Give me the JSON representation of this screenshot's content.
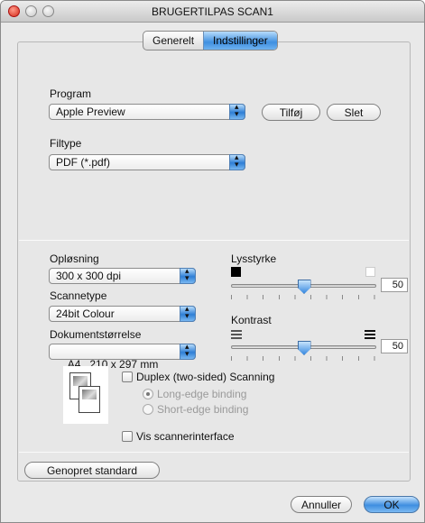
{
  "window": {
    "title": "BRUGERTILPAS SCAN1"
  },
  "tabs": [
    {
      "label": "Generelt",
      "active": false
    },
    {
      "label": "Indstillinger",
      "active": true
    }
  ],
  "program": {
    "label": "Program",
    "value": "Apple Preview",
    "add_button": "Tilføj",
    "delete_button": "Slet"
  },
  "filetype": {
    "label": "Filtype",
    "value": "PDF (*.pdf)"
  },
  "resolution": {
    "label": "Opløsning",
    "value": "300 x 300 dpi"
  },
  "scantype": {
    "label": "Scannetype",
    "value": "24bit Colour"
  },
  "docsize": {
    "label": "Dokumentstørrelse",
    "value": "A4   210 x 297 mm"
  },
  "brightness": {
    "label": "Lysstyrke",
    "value": "50",
    "level": 50
  },
  "contrast": {
    "label": "Kontrast",
    "value": "50",
    "level": 50
  },
  "duplex": {
    "label": "Duplex (two-sided) Scanning",
    "checked": false,
    "long_edge": "Long-edge binding",
    "short_edge": "Short-edge binding"
  },
  "show_interface": {
    "label": "Vis scannerinterface",
    "checked": false
  },
  "footer": {
    "restore_label": "Genopret standard",
    "cancel_label": "Annuller",
    "ok_label": "OK"
  },
  "colors": {
    "accent": "#3f8fe0"
  }
}
